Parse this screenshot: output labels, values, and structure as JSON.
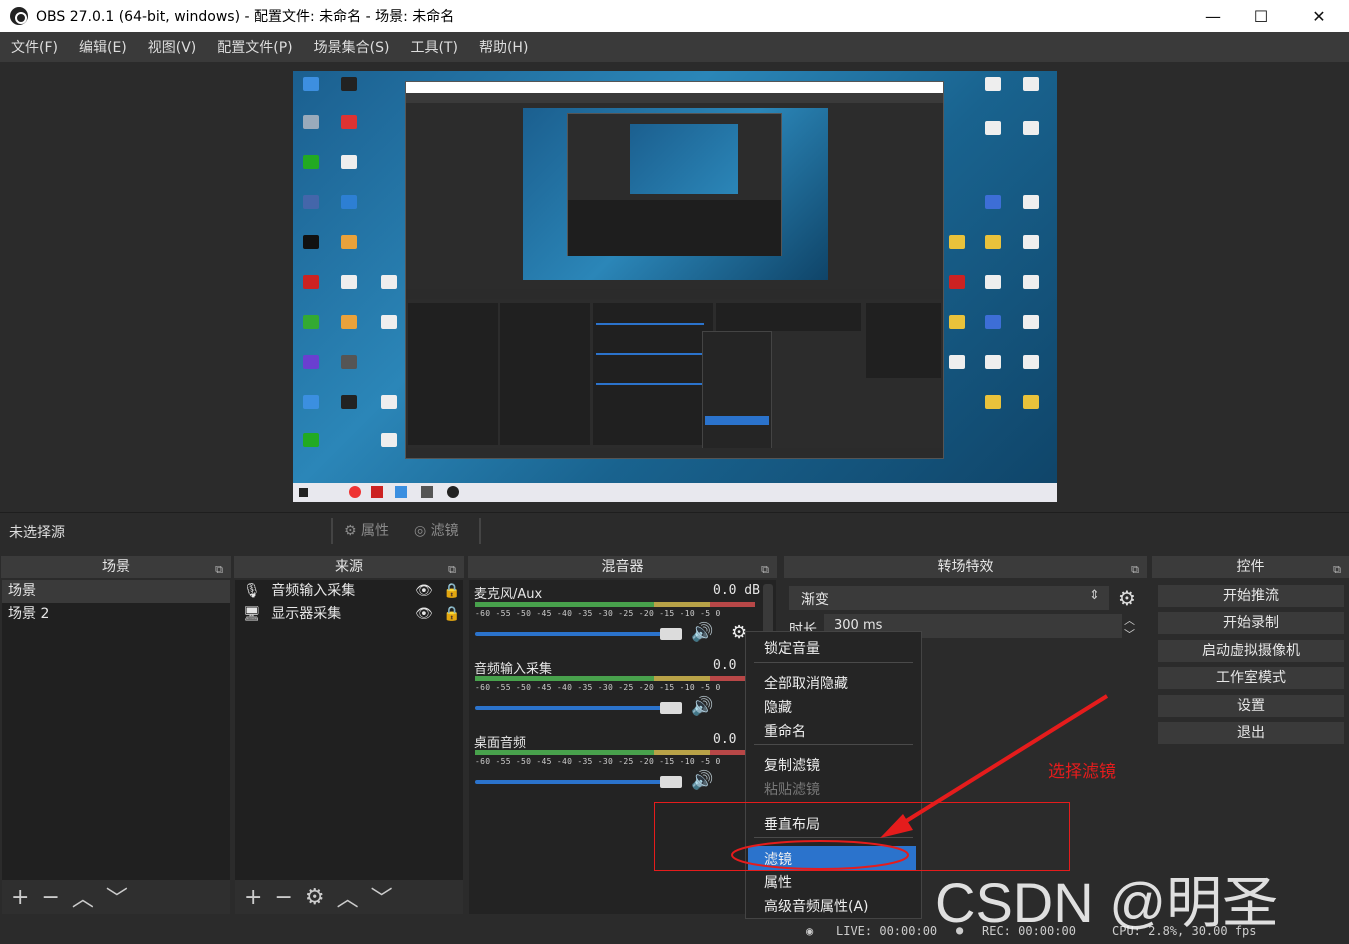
{
  "window": {
    "title": "OBS 27.0.1 (64-bit, windows) - 配置文件: 未命名 - 场景: 未命名",
    "min": "—",
    "max": "☐",
    "close": "✕"
  },
  "menu": [
    "文件(F)",
    "编辑(E)",
    "视图(V)",
    "配置文件(P)",
    "场景集合(S)",
    "工具(T)",
    "帮助(H)"
  ],
  "source_bar": {
    "no_source": "未选择源",
    "properties": "属性",
    "filters": "滤镜"
  },
  "docks": {
    "scenes": {
      "title": "场景",
      "items": [
        "场景",
        "场景 2"
      ]
    },
    "sources": {
      "title": "来源",
      "items": [
        "音频输入采集",
        "显示器采集"
      ]
    },
    "mixer": {
      "title": "混音器",
      "channels": [
        {
          "name": "麦克风/Aux",
          "value": "0.0 dB"
        },
        {
          "name": "音频输入采集",
          "value": "0.0"
        },
        {
          "name": "桌面音频",
          "value": "0.0"
        }
      ],
      "ticks": "-60 -55 -50 -45 -40 -35 -30 -25 -20 -15 -10 -5 0"
    },
    "transitions": {
      "title": "转场特效",
      "selected": "渐变",
      "duration_label": "时长",
      "duration_value": "300 ms"
    },
    "controls": {
      "title": "控件",
      "buttons": [
        "开始推流",
        "开始录制",
        "启动虚拟摄像机",
        "工作室模式",
        "设置",
        "退出"
      ]
    }
  },
  "context_menu": {
    "items": [
      "锁定音量",
      "全部取消隐藏",
      "隐藏",
      "重命名",
      "复制滤镜",
      "粘贴滤镜",
      "垂直布局",
      "滤镜",
      "属性",
      "高级音频属性(A)"
    ],
    "highlighted": "滤镜"
  },
  "annotation": {
    "text": "选择滤镜",
    "color": "#e51c1c"
  },
  "status": {
    "live": "LIVE: 00:00:00",
    "rec": "REC: 00:00:00",
    "cpu": "CPU: 2.8%, 30.00 fps"
  },
  "watermark": "CSDN @明圣"
}
